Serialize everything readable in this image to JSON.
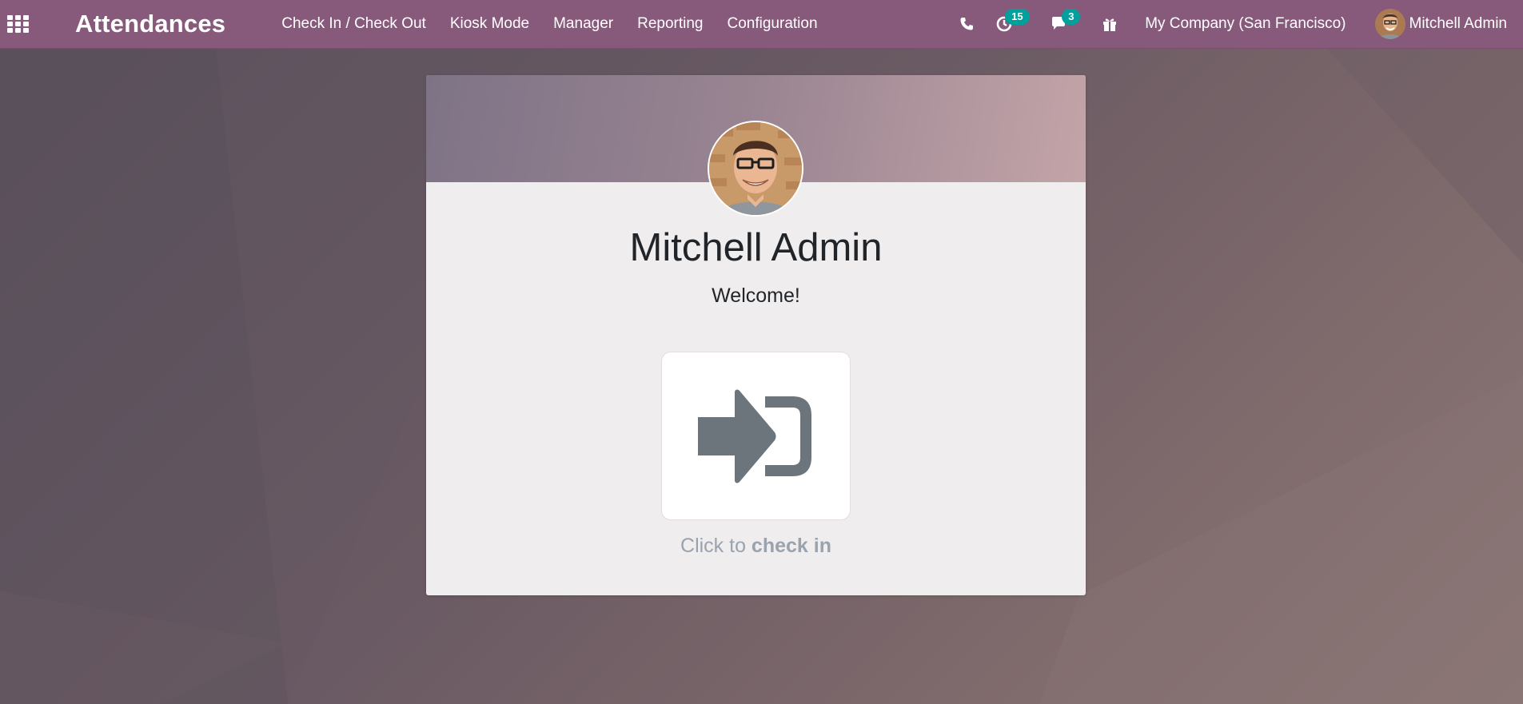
{
  "app": {
    "title": "Attendances"
  },
  "menu": [
    {
      "label": "Check In / Check Out"
    },
    {
      "label": "Kiosk Mode"
    },
    {
      "label": "Manager"
    },
    {
      "label": "Reporting"
    },
    {
      "label": "Configuration"
    }
  ],
  "systray": {
    "phone_icon": "phone-icon",
    "activity": {
      "icon": "clock-icon",
      "count": "15"
    },
    "messages": {
      "icon": "chat-icon",
      "count": "3"
    },
    "gift_icon": "gift-icon",
    "company": "My Company (San Francisco)",
    "user_name": "Mitchell Admin"
  },
  "card": {
    "employee_name": "Mitchell Admin",
    "greeting": "Welcome!",
    "action_icon": "sign-in-icon",
    "click_prefix": "Click to ",
    "click_action": "check in"
  },
  "colors": {
    "navbar": "#875a7b",
    "badge": "#00a09d",
    "icon_gray": "#6c747c"
  }
}
